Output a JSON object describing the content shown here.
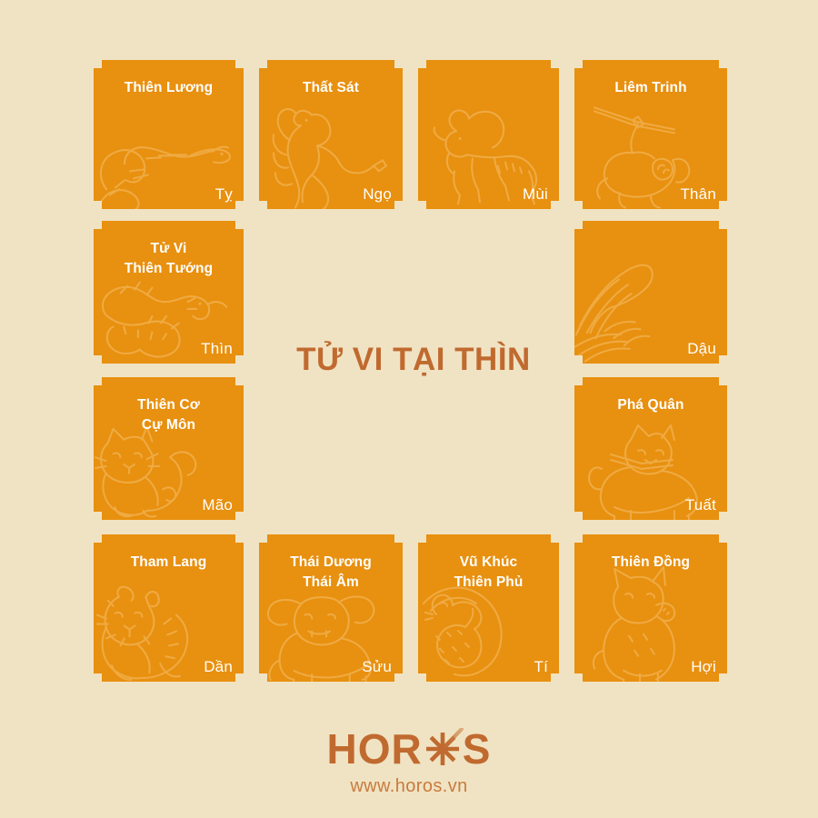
{
  "theme": {
    "background": "#F0E3C3",
    "card_color": "#E8900F",
    "card_text": "#FFFFFF",
    "accent": "#C06A30",
    "url_color": "#C87B3E"
  },
  "center": {
    "title": "TỬ VI TẠI THÌN"
  },
  "logo": {
    "wordmark_left": "HOR",
    "wordmark_right": "S",
    "star_icon": "asterisk-star-icon",
    "url": "www.horos.vn"
  },
  "cards": [
    {
      "id": "ty",
      "title": "Thiên Lương",
      "branch": "Tỵ",
      "animal": "snake-icon",
      "row": 1,
      "col": 1
    },
    {
      "id": "ngo",
      "title": "Thất Sát",
      "branch": "Ngọ",
      "animal": "horse-icon",
      "row": 1,
      "col": 2
    },
    {
      "id": "mui",
      "title": "",
      "branch": "Mùi",
      "animal": "goat-icon",
      "row": 1,
      "col": 3
    },
    {
      "id": "than",
      "title": "Liêm Trinh",
      "branch": "Thân",
      "animal": "monkey-icon",
      "row": 1,
      "col": 4
    },
    {
      "id": "thin",
      "title": "Tử Vi\nThiên Tướng",
      "branch": "Thìn",
      "animal": "dragon-icon",
      "row": 2,
      "col": 1
    },
    {
      "id": "dau",
      "title": "",
      "branch": "Dậu",
      "animal": "rooster-icon",
      "row": 2,
      "col": 4
    },
    {
      "id": "mao",
      "title": "Thiên Cơ\nCự Môn",
      "branch": "Mão",
      "animal": "cat-icon",
      "row": 3,
      "col": 1
    },
    {
      "id": "tuat",
      "title": "Phá Quân",
      "branch": "Tuất",
      "animal": "dog-icon",
      "row": 3,
      "col": 4
    },
    {
      "id": "dan",
      "title": "Tham Lang",
      "branch": "Dần",
      "animal": "tiger-icon",
      "row": 4,
      "col": 1
    },
    {
      "id": "suu",
      "title": "Thái Dương\nThái Âm",
      "branch": "Sửu",
      "animal": "ox-icon",
      "row": 4,
      "col": 2
    },
    {
      "id": "ti",
      "title": "Vũ Khúc\nThiên Phủ",
      "branch": "Tí",
      "animal": "rat-icon",
      "row": 4,
      "col": 3
    },
    {
      "id": "hoi",
      "title": "Thiên Đồng",
      "branch": "Hợi",
      "animal": "pig-icon",
      "row": 4,
      "col": 4
    }
  ]
}
